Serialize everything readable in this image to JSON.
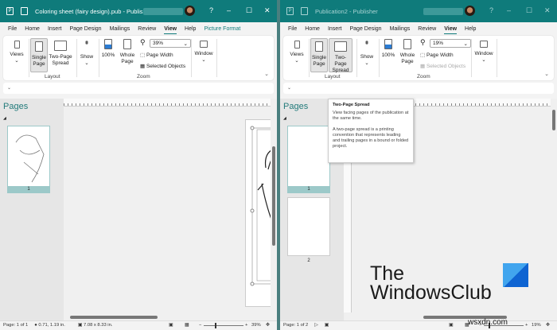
{
  "windows": [
    {
      "title": "Coloring sheet (fairy design).pub  -  Publis...",
      "help": "?",
      "tabs": [
        "File",
        "Home",
        "Insert",
        "Page Design",
        "Mailings",
        "Review",
        "View",
        "Help",
        "Picture Format"
      ],
      "ribbon": {
        "views": "Views",
        "single_page": [
          "Single",
          "Page"
        ],
        "two_page": [
          "Two-Page",
          "Spread"
        ],
        "layout": "Layout",
        "show": "Show",
        "p100": "100%",
        "whole_page": [
          "Whole",
          "Page"
        ],
        "zoom_value": "39%",
        "page_width": "Page Width",
        "selected_objects": "Selected Objects",
        "zoom": "Zoom",
        "window": "Window"
      },
      "pages_title": "Pages",
      "thumbs": [
        "1"
      ],
      "status": {
        "page": "Page: 1 of 1",
        "position": "0.71, 1.19 in.",
        "size": "7.08 x 8.33 in.",
        "zoom": "39%"
      }
    },
    {
      "title": "Publication2  -  Publisher",
      "help": "?",
      "tabs": [
        "File",
        "Home",
        "Insert",
        "Page Design",
        "Mailings",
        "Review",
        "View",
        "Help"
      ],
      "ribbon": {
        "views": "Views",
        "single_page": [
          "Single",
          "Page"
        ],
        "two_page": [
          "Two-Page",
          "Spread"
        ],
        "layout": "Layout",
        "show": "Show",
        "p100": "100%",
        "whole_page": [
          "Whole",
          "Page"
        ],
        "zoom_value": "19%",
        "page_width": "Page Width",
        "selected_objects": "Selected Objects",
        "zoom": "Zoom",
        "window": "Window"
      },
      "pages_title": "Pages",
      "thumbs": [
        "1",
        "2"
      ],
      "status": {
        "page": "Page: 1 of 2",
        "zoom": "19%"
      }
    }
  ],
  "tooltip": {
    "title": "Two-Page Spread",
    "line1": "View facing pages of the publication at the same time.",
    "line2": "A two-page spread is a printing convention that represents leading and trailing pages in a bound or folded project."
  },
  "watermark": {
    "line1": "The",
    "line2": "WindowsClub",
    "site": "wsxdn.com"
  },
  "colors": {
    "titlebar": "#0f7b7b",
    "accent": "#237b7b",
    "thumb_selected": "#9cc9c9"
  }
}
